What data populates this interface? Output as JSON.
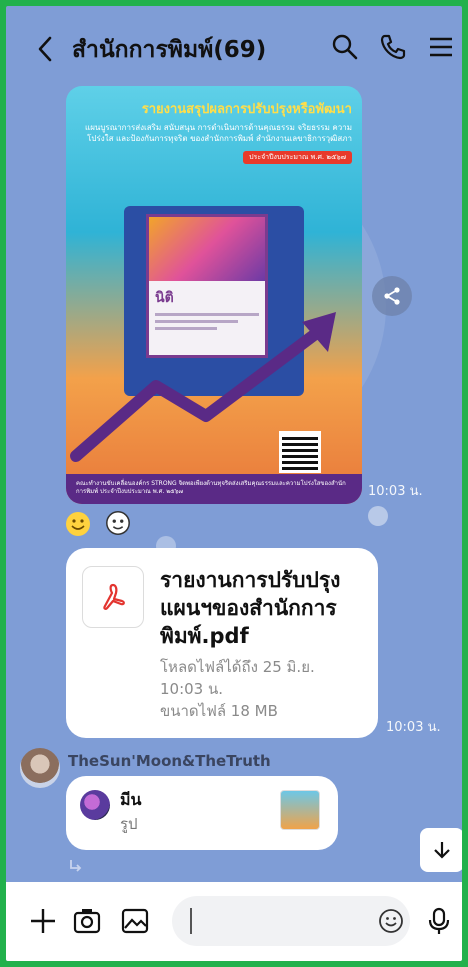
{
  "header": {
    "title": "สำนักการพิมพ์(69)"
  },
  "poster": {
    "headline": "รายงานสรุปผลการปรับปรุงหรือพัฒนา",
    "subline": "แผนบูรณาการส่งเสริม สนับสนุน การดำเนินการด้านคุณธรรม จริยธรรม ความโปร่งใส และป้องกันการทุจริต ของสำนักการพิมพ์ สำนักงานเลขาธิการวุฒิสภา",
    "year_tag": "ประจำปีงบประมาณ พ.ศ. ๒๕๖๗",
    "screen_label": "นิติ",
    "footer": "คณะทำงานขับเคลื่อนองค์กร STRONG จิตพอเพียงต้านทุจริตส่งเสริมคุณธรรมและความโปร่งใสของสำนักการพิมพ์ ประจำปีงบประมาณ พ.ศ. ๒๕๖๗",
    "time": "10:03 น."
  },
  "file_message": {
    "name": "รายงานการปรับปรุงแผนฯของสำนักการพิมพ์.pdf",
    "download_until": "โหลดไฟล์ได้ถึง 25 มิ.ย.",
    "download_time": "10:03 น.",
    "size": "ขนาดไฟล์ 18 MB",
    "time": "10:03 น."
  },
  "sender_message": {
    "sender": "TheSun'Moon&TheTruth",
    "reply_name": "มีน",
    "reply_type": "รูป"
  },
  "icons": {
    "back": "chevron-left-icon",
    "search": "search-icon",
    "call": "phone-icon",
    "menu": "menu-icon",
    "share": "share-icon",
    "pdf": "pdf-icon",
    "down": "arrow-down-icon",
    "add": "plus-icon",
    "camera": "camera-icon",
    "gallery": "image-icon",
    "emoji": "emoji-icon",
    "mic": "microphone-icon"
  },
  "colors": {
    "background": "#7f9dd6",
    "frame": "#22b14c",
    "pdf_red": "#e3342f"
  }
}
